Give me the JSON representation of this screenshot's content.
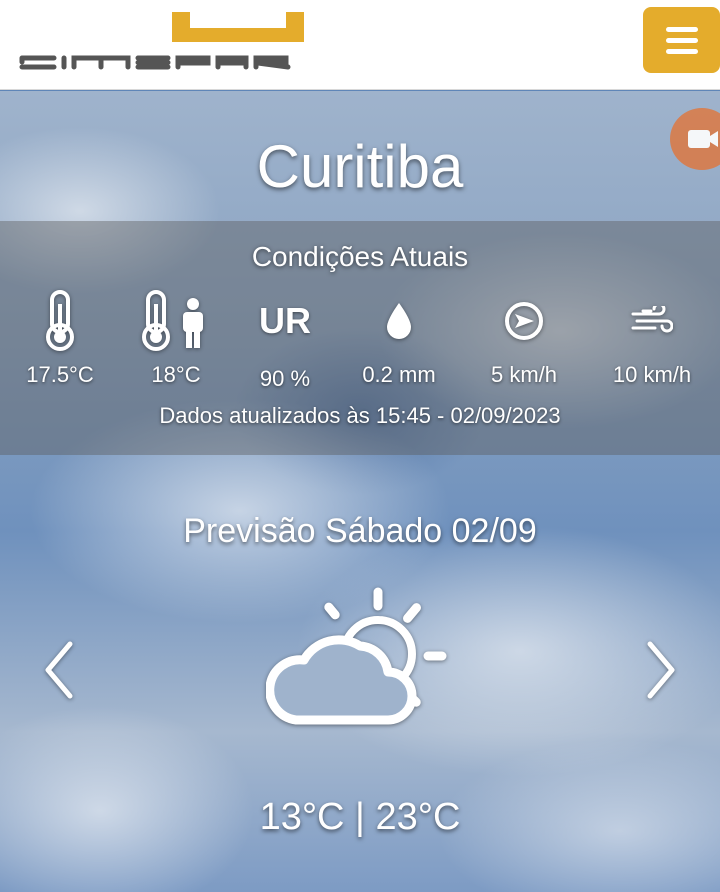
{
  "header": {
    "logo_text": "SIMEPAR",
    "menu_icon": "hamburger-icon",
    "colors": {
      "menu_button": "#e4ac2c",
      "logo_accent": "#e4ac2c",
      "logo_text": "#555555"
    }
  },
  "camera_icon": "camera-icon",
  "city": "Curitiba",
  "current": {
    "title": "Condições Atuais",
    "metrics": [
      {
        "icon": "thermometer-icon",
        "value": "17.5°C"
      },
      {
        "icon": "feels-like-icon",
        "value": "18°C"
      },
      {
        "icon": "humidity-icon",
        "label": "UR",
        "value": "90 %"
      },
      {
        "icon": "rain-drop-icon",
        "value": "0.2 mm"
      },
      {
        "icon": "wind-direction-icon",
        "value": "5 km/h"
      },
      {
        "icon": "wind-gust-icon",
        "value": "10 km/h"
      }
    ],
    "updated": "Dados atualizados às 15:45 - 02/09/2023"
  },
  "forecast": {
    "title": "Previsão Sábado 02/09",
    "icon": "partly-cloudy-icon",
    "temps": "13°C | 23°C",
    "prev_icon": "chevron-left-icon",
    "next_icon": "chevron-right-icon"
  }
}
